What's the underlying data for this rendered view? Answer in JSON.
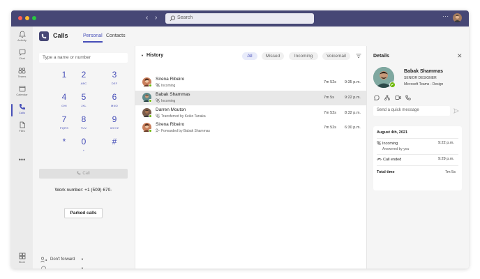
{
  "titlebar": {
    "search_placeholder": "Search",
    "more_label": "···",
    "back_arrow": "‹",
    "forward_arrow": "›"
  },
  "rail": {
    "items": [
      {
        "label": "Activity",
        "icon": "bell-icon"
      },
      {
        "label": "Chat",
        "icon": "chat-icon"
      },
      {
        "label": "Teams",
        "icon": "teams-icon"
      },
      {
        "label": "Calendar",
        "icon": "calendar-icon"
      },
      {
        "label": "Calls",
        "icon": "phone-icon"
      },
      {
        "label": "Files",
        "icon": "file-icon"
      }
    ],
    "more": "•••",
    "store": {
      "label": "Store",
      "icon": "store-icon"
    },
    "active": "Calls"
  },
  "header": {
    "title": "Calls",
    "tabs": [
      "Personal",
      "Contacts"
    ],
    "active_tab": "Personal"
  },
  "dialpad": {
    "input_placeholder": "Type a name or number",
    "keys": [
      {
        "digit": "1",
        "letters": ""
      },
      {
        "digit": "2",
        "letters": "ABC"
      },
      {
        "digit": "3",
        "letters": "DEF"
      },
      {
        "digit": "4",
        "letters": "GHI"
      },
      {
        "digit": "5",
        "letters": "JKL"
      },
      {
        "digit": "6",
        "letters": "MNO"
      },
      {
        "digit": "7",
        "letters": "PQRS"
      },
      {
        "digit": "8",
        "letters": "TUV"
      },
      {
        "digit": "9",
        "letters": "WXYZ"
      },
      {
        "digit": "*",
        "letters": ""
      },
      {
        "digit": "0",
        "letters": "+"
      },
      {
        "digit": "#",
        "letters": ""
      }
    ],
    "call_label": "Call",
    "work_number": "Work number: +1 (509) 670-",
    "parked_calls_label": "Parked calls",
    "forward_label": "Don't forward",
    "device_label": ""
  },
  "history": {
    "title": "History",
    "filters": [
      "All",
      "Missed",
      "Incoming",
      "Voicemail"
    ],
    "active_filter": "All",
    "rows": [
      {
        "name": "Sirena Ribeiro",
        "sub": "Incoming",
        "duration": "7m 52s",
        "time": "9:35 p.m.",
        "avatar_color": "#c97f5c"
      },
      {
        "name": "Babak Shammas",
        "sub": "Incoming",
        "duration": "7m 5s",
        "time": "9:22 p.m.",
        "avatar_color": "#5e8a8a",
        "selected": true
      },
      {
        "name": "Darren Mouton",
        "sub": "Transferred by Keiko Tanaka",
        "duration": "7m 52s",
        "time": "8:32 p.m.",
        "avatar_color": "#7a5c4a"
      },
      {
        "name": "Sirena Ribeiro",
        "sub": "Forwarded by Babak Shammas",
        "duration": "7m 52s",
        "time": "6:30 p.m.",
        "avatar_color": "#c97f5c"
      }
    ]
  },
  "details": {
    "title": "Details",
    "close_label": "✕",
    "person": {
      "name": "Babak Shammas",
      "role": "SENIOR DESIGNER",
      "org": "Microsoft Teams - Design"
    },
    "quick_message_placeholder": "Send a quick message",
    "card": {
      "date": "August 4th, 2021",
      "events": [
        {
          "label": "Incoming",
          "time": "9:22 p.m.",
          "sub": "Answered by you"
        },
        {
          "label": "Call ended",
          "time": "9:29 p.m.",
          "sub": ""
        }
      ],
      "total_label": "Total time",
      "total_value": "7m 5s"
    }
  },
  "colors": {
    "brand": "#464775",
    "accent": "#464eb8",
    "presence_available": "#6bb700"
  }
}
